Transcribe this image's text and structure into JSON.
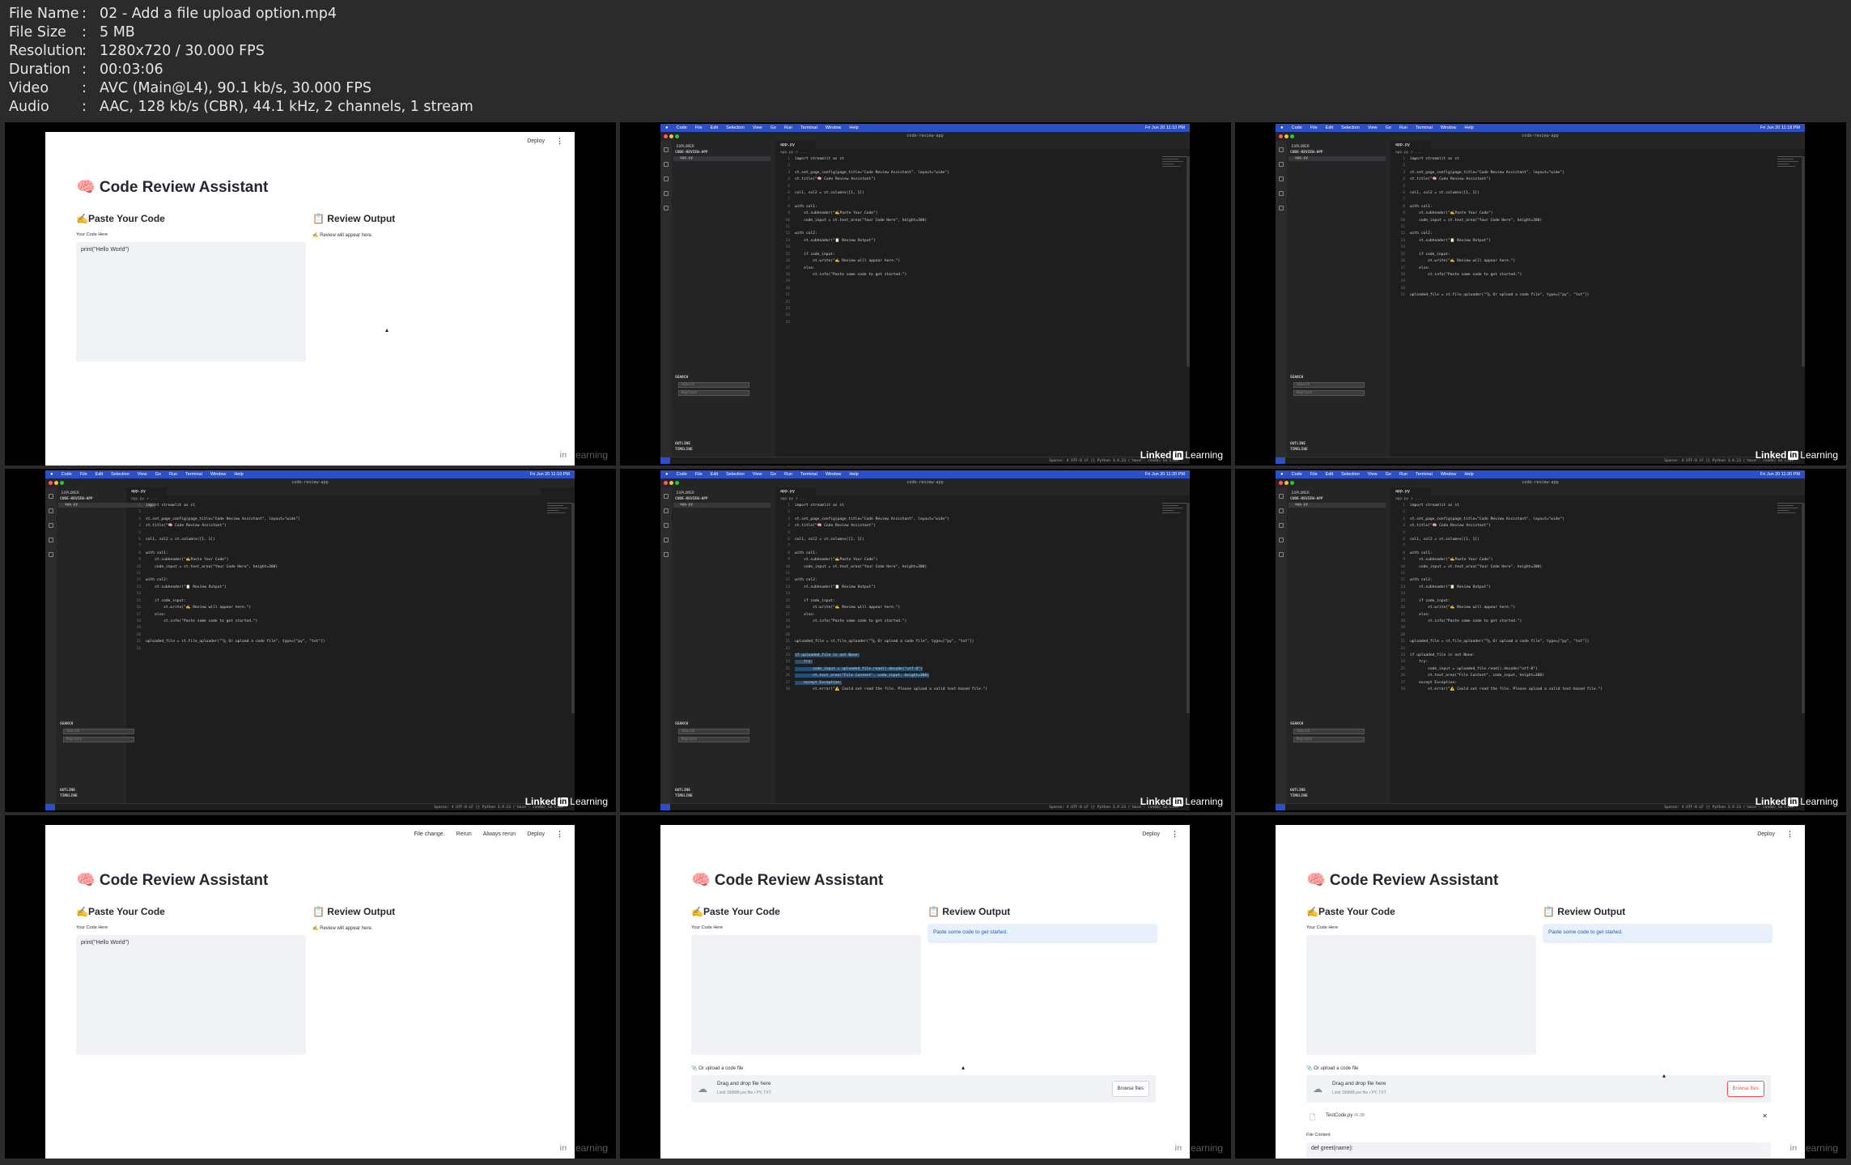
{
  "header": {
    "rows": [
      {
        "key": "File Name",
        "value": "02 - Add a file upload option.mp4"
      },
      {
        "key": "File Size",
        "value": "5 MB"
      },
      {
        "key": "Resolution",
        "value": "1280x720 / 30.000 FPS"
      },
      {
        "key": "Duration",
        "value": "00:03:06"
      },
      {
        "key": "Video",
        "value": "AVC (Main@L4), 90.1 kb/s, 30.000 FPS"
      },
      {
        "key": "Audio",
        "value": "AAC, 128 kb/s (CBR), 44.1 kHz, 2 channels, 1 stream"
      }
    ]
  },
  "watermark": {
    "linked": "Linked",
    "in": "in",
    "learning": "Learning"
  },
  "app": {
    "deploy": "Deploy",
    "menu": "⋮",
    "title": "🧠 Code Review Assistant",
    "left_header": "✍️Paste Your Code",
    "right_header": "📋 Review Output",
    "code_label": "Your Code Here",
    "sample_code": "print(\"Hello World\")",
    "review_placeholder": "✍️ Review will appear here.",
    "info_message": "Paste some code to get started.",
    "rerun_bar": {
      "file_change": "File change.",
      "rerun": "Rerun",
      "always_rerun": "Always rerun"
    },
    "upload_label": "📎 Or upload a code file",
    "dropzone_title": "Drag and drop file here",
    "dropzone_limit": "Limit 200MB per file • PY, TXT",
    "browse": "Browse files",
    "uploaded_file": "TestCode.py",
    "uploaded_size": "45.0B",
    "file_content_label": "File Content",
    "file_content_preview": "def greet(name):"
  },
  "vscode": {
    "mac_menu": [
      "Code",
      "File",
      "Edit",
      "Selection",
      "View",
      "Go",
      "Run",
      "Terminal",
      "Window",
      "Help"
    ],
    "window_title": "code-review-app",
    "explorer": "EXPLORER",
    "project": "CODE-REVIEW-APP",
    "file": "app.py",
    "search_header": "SEARCH",
    "search_placeholder": "Search",
    "replace_placeholder": "Replace",
    "outline": "OUTLINE",
    "timeline": "TIMELINE",
    "breadcrumb": "app.py > ...",
    "status_text": "Spaces: 4   UTF-8   LF   {} Python   3.9.13 ('base': conda)   Go Live",
    "times": [
      "Fri Jun 20 11:10 PM",
      "Fri Jun 20 11:18 PM",
      "Fri Jun 20 11:19 PM",
      "Fri Jun 20 11:20 PM",
      "Fri Jun 20 11:20 PM"
    ],
    "base_code": [
      "import streamlit as st",
      "",
      "st.set_page_config(page_title=\"Code Review Assistant\", layout=\"wide\")",
      "st.title(\"🧠 Code Review Assistant\")",
      "",
      "col1, col2 = st.columns([1, 1])",
      "",
      "with col1:",
      "    st.subheader(\"✍️Paste Your Code\")",
      "    code_input = st.text_area(\"Your Code Here\", height=300)",
      "",
      "with col2:",
      "    st.subheader(\"📋 Review Output\")",
      "",
      "    if code_input:",
      "        st.write(\"✍️ Review will appear here.\")",
      "    else:",
      "        st.info(\"Paste some code to get started.\")"
    ],
    "upload_line": "uploaded_file = st.file_uploader(\"📎 Or upload a code file\", type=[\"py\", \"txt\"])",
    "upload_block": [
      "if uploaded_file is not None:",
      "    try:",
      "        code_input = uploaded_file.read().decode(\"utf-8\")",
      "        st.text_area(\"File Content\", code_input, height=300)",
      "    except Exception:",
      "        st.error(\"⚠️ Could not read the file. Please upload a valid text-based file.\")"
    ]
  }
}
